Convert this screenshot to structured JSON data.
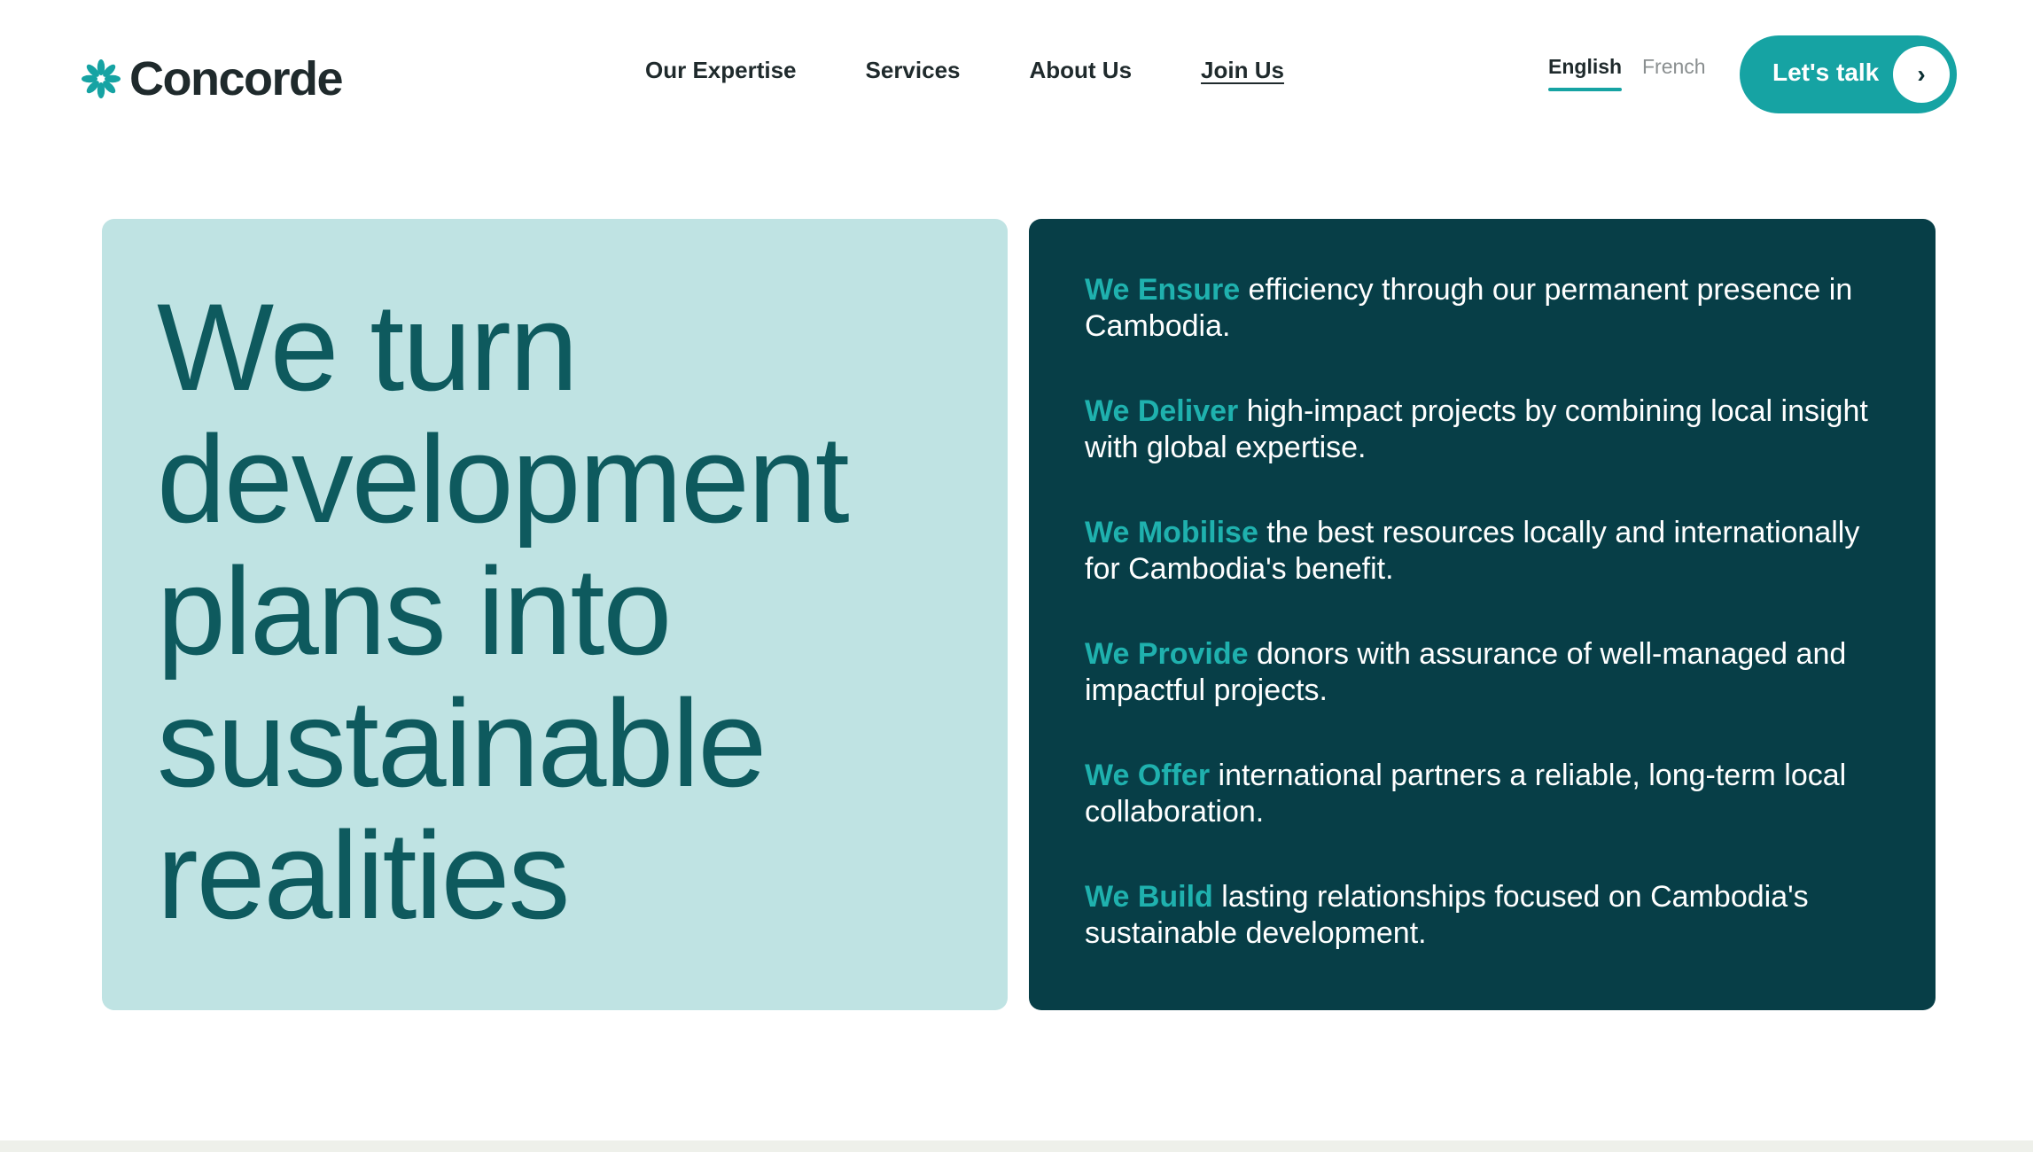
{
  "brand": {
    "name": "Concorde",
    "accent": "#16a3a3",
    "dark": "#073e47",
    "light": "#bfe3e3"
  },
  "nav": {
    "items": [
      "Our Expertise",
      "Services",
      "About Us",
      "Join Us"
    ]
  },
  "language": {
    "options": [
      "English",
      "French"
    ],
    "selected": "English"
  },
  "cta": {
    "label": "Let's talk",
    "icon": "chevron-right-icon"
  },
  "hero": {
    "headline": "We turn development plans into sustainable realities",
    "statements": [
      {
        "keyword": "We Ensure",
        "text": " efficiency through our permanent presence in Cambodia."
      },
      {
        "keyword": "We Deliver",
        "text": " high-impact projects by combining local insight with global expertise."
      },
      {
        "keyword": "We Mobilise",
        "text": " the best resources locally and internationally for Cambodia's benefit."
      },
      {
        "keyword": "We Provide",
        "text": " donors with assurance of well-managed and impactful projects."
      },
      {
        "keyword": "We Offer",
        "text": " international partners a reliable, long-term local collaboration."
      },
      {
        "keyword": "We Build",
        "text": " lasting relationships focused on Cambodia's sustainable development."
      }
    ]
  }
}
